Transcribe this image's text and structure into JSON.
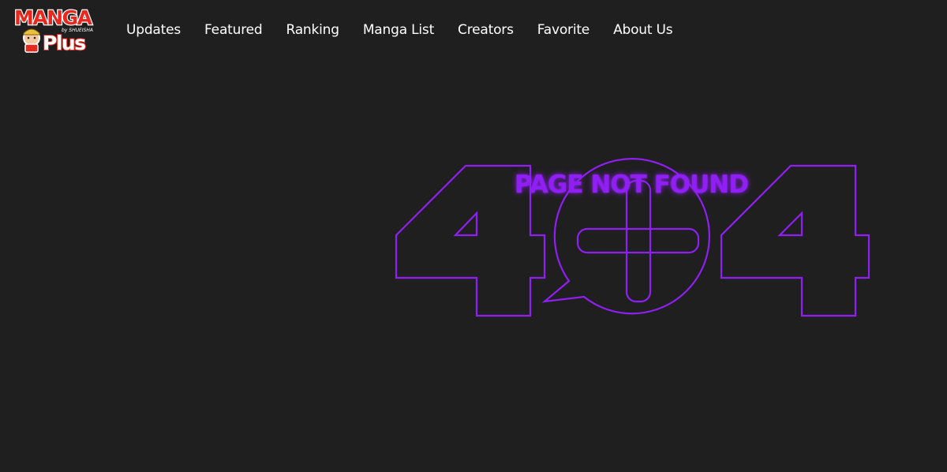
{
  "brand": {
    "logo_top": "MANGA",
    "logo_bottom": "Plus",
    "logo_tag": "by SHUEISHA",
    "colors": {
      "red": "#e8281e",
      "white": "#ffffff"
    }
  },
  "nav": {
    "items": [
      {
        "label": "Updates"
      },
      {
        "label": "Featured"
      },
      {
        "label": "Ranking"
      },
      {
        "label": "Manga List"
      },
      {
        "label": "Creators"
      },
      {
        "label": "Favorite"
      },
      {
        "label": "About Us"
      }
    ]
  },
  "error": {
    "headline": "PAGE NOT FOUND",
    "code_left": "4",
    "code_right": "4",
    "accent_color": "#8f1ff2",
    "center_icon": "speech-bubble-plus-icon"
  }
}
